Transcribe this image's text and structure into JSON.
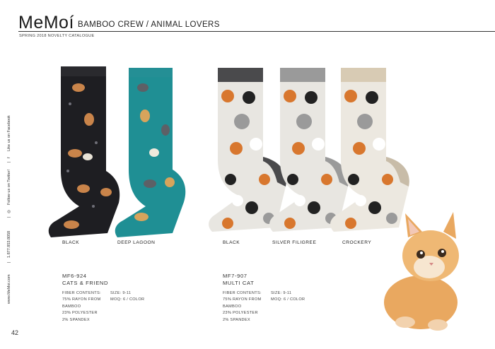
{
  "header": {
    "logo": "MeMoí",
    "breadcrumb": "BAMBOO CREW  /  ANIMAL LOVERS",
    "subtitle": "SPRING 2018 NOVELTY CATALOGUE"
  },
  "sidebar": {
    "website": "www.MeMoi.com",
    "phone": "1.877.853.8058",
    "twitter": "Follow us on Twitter!",
    "facebook": "Like us on Facebook"
  },
  "products": [
    {
      "code": "MF6-924",
      "name": "CATS & FRIEND",
      "colors": [
        "BLACK",
        "DEEP LAGOON"
      ],
      "fiber_label": "FIBER CONTENTS:",
      "fiber_lines": [
        "75% RAYON FROM",
        "BAMBOO",
        "23% POLYESTER",
        "2% SPANDEX"
      ],
      "size": "SIZE: 9-11",
      "moq": "MOQ: 6 / COLOR"
    },
    {
      "code": "MF7-907",
      "name": "MULTI CAT",
      "colors": [
        "BLACK",
        "SILVER FILIGREE",
        "CROCKERY"
      ],
      "fiber_label": "FIBER CONTENTS:",
      "fiber_lines": [
        "75% RAYON FROM",
        "BAMBOO",
        "23% POLYESTER",
        "2% SPANDEX"
      ],
      "size": "SIZE: 9-11",
      "moq": "MOQ: 6 / COLOR"
    }
  ],
  "page_number": "42",
  "colors": {
    "black_sock": "#1e1e22",
    "lagoon_sock": "#1f8f94",
    "silver_cuff": "#9a9a9a",
    "crockery_cuff": "#d8cbb4",
    "orange_cat": "#d8772e"
  }
}
